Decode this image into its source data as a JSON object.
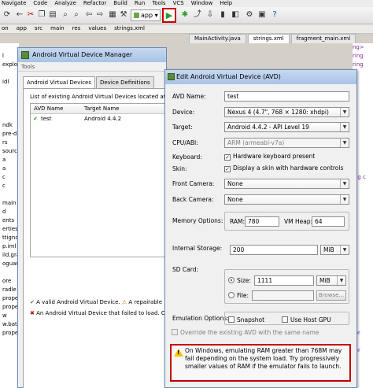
{
  "ide": {
    "menu": [
      "Navigate",
      "Code",
      "Analyze",
      "Refactor",
      "Build",
      "Run",
      "Tools",
      "VCS",
      "Window",
      "Help"
    ],
    "run_config": "app",
    "breadcrumb": [
      "on",
      "app",
      "src",
      "main",
      "res",
      "values",
      "strings.xml"
    ],
    "editor_tabs": [
      "MainActivity.java",
      "strings.xml",
      "fragment_main.xml"
    ],
    "editor_tab_selected": 1,
    "tree_items": [
      "",
      "l",
      "explo",
      "",
      "idl",
      "",
      "",
      "",
      "",
      "ndk",
      "pre-d",
      "rs",
      "sourc",
      "a",
      "a",
      "c",
      "c",
      "",
      "main",
      "d",
      "ents",
      "erties",
      "ttignore",
      "p.iml",
      "ild.gradle",
      "oguard-rules.txt",
      "",
      "ore",
      "radle",
      "properties",
      "properties",
      "w",
      "w.bat",
      "properties"
    ],
    "editor_fragments": [
      "ng>",
      "ring",
      "ring",
      "",
      "",
      "",
      "",
      "",
      "",
      "",
      "",
      "",
      "",
      "",
      "",
      "ing c",
      "",
      "",
      "",
      "",
      "",
      "",
      "",
      "",
      "",
      "",
      "",
      "",
      "",
      "",
      "",
      "",
      "",
      "tor",
      "",
      "tor"
    ]
  },
  "avd_manager": {
    "title": "Android Virtual Device Manager",
    "menu": "Tools",
    "tabs": [
      "Android Virtual Devices",
      "Device Definitions"
    ],
    "list_label": "List of existing Android Virtual Devices located at C:",
    "columns": [
      "AVD Name",
      "Target Name"
    ],
    "rows": [
      {
        "name": "test",
        "target": "Android 4.4.2",
        "status": "valid"
      }
    ],
    "legend_valid": "A valid Android Virtual Device.",
    "legend_repairable": "A repairable",
    "legend_failed": "An Android Virtual Device that failed to load. Cli"
  },
  "dialog": {
    "title": "Edit Android Virtual Device (AVD)",
    "avd_name_label": "AVD Name:",
    "avd_name_value": "test",
    "device_label": "Device:",
    "device_value": "Nexus 4 (4.7\", 768 × 1280: xhdpi)",
    "target_label": "Target:",
    "target_value": "Android 4.4.2 - API Level 19",
    "cpu_label": "CPU/ABI:",
    "cpu_value": "ARM (armeabi-v7a)",
    "keyboard_label": "Keyboard:",
    "keyboard_check": "Hardware keyboard present",
    "keyboard_checked": true,
    "skin_label": "Skin:",
    "skin_check": "Display a skin with hardware controls",
    "skin_checked": true,
    "front_camera_label": "Front Camera:",
    "front_camera_value": "None",
    "back_camera_label": "Back Camera:",
    "back_camera_value": "None",
    "memory_label": "Memory Options:",
    "ram_label": "RAM:",
    "ram_value": "780",
    "vm_heap_label": "VM Heap:",
    "vm_heap_value": "64",
    "internal_storage_label": "Internal Storage:",
    "internal_storage_value": "200",
    "internal_storage_unit": "MiB",
    "sd_card_label": "SD Card:",
    "size_label": "Size:",
    "size_value": "1111",
    "size_unit": "MiB",
    "file_label": "File:",
    "file_value": "",
    "browse_label": "Browse...",
    "emulation_label": "Emulation Options:",
    "snapshot_label": "Snapshot",
    "host_gpu_label": "Use Host GPU",
    "override_label": "Override the existing AVD with the same name",
    "warning": "On Windows, emulating RAM greater than 768M may fail depending on the system load. Try progressively smaller values of RAM if the emulator fails to launch."
  }
}
